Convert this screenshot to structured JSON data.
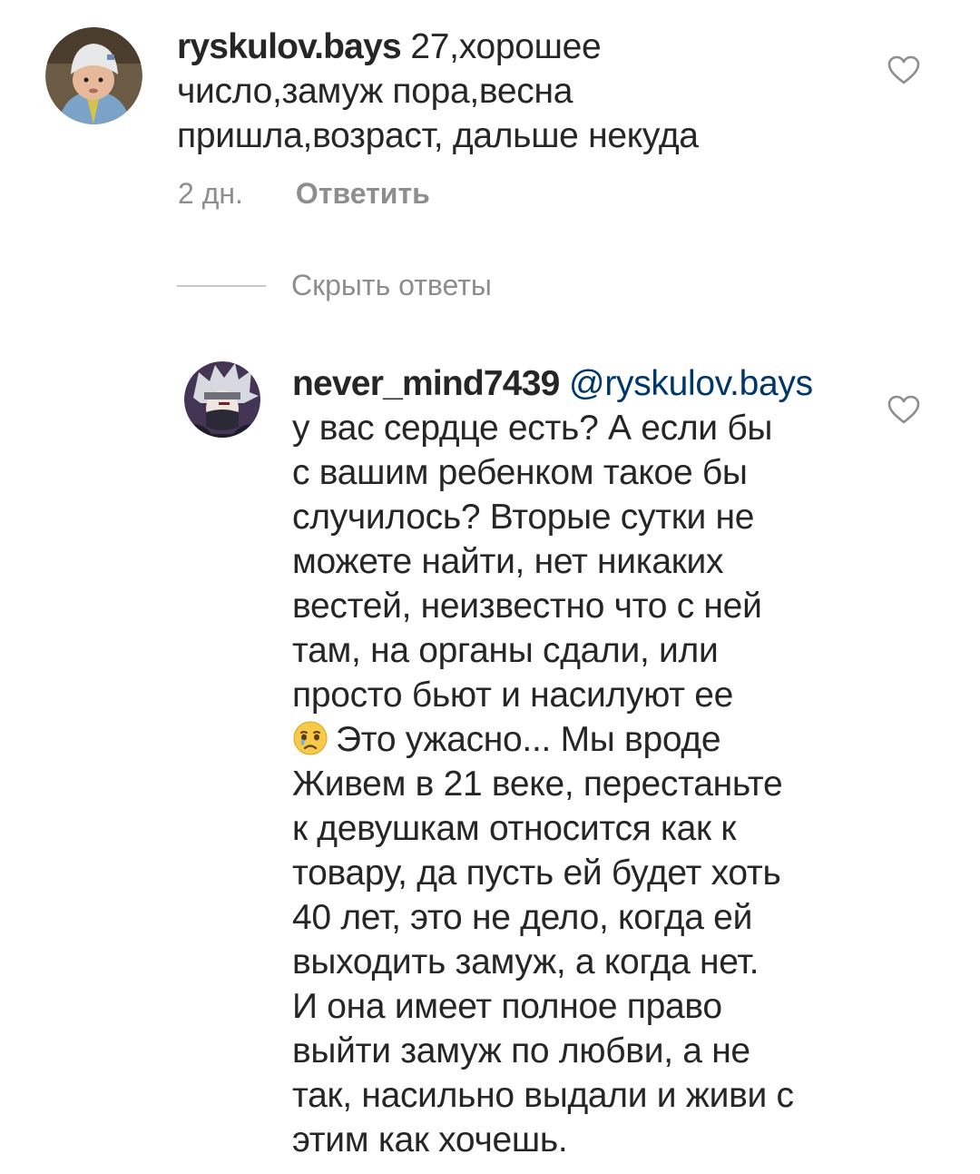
{
  "comment": {
    "username": "ryskulov.bays",
    "text": " 27,хорошее\nчисло,замуж пора,весна\nпришла,возраст, дальше некуда",
    "time": "2 дн.",
    "reply_label": "Ответить",
    "like_icon": "heart-outline-icon"
  },
  "hide_replies_label": "Скрыть ответы",
  "reply": {
    "username": "never_mind7439",
    "mention": "@ryskulov.bays",
    "text_before_emoji": "\nу вас сердце есть? А если бы\nс вашим ребенком такое бы\nслучилось? Вторые сутки не\nможете найти, нет никаких\nвестей, неизвестно что с ней\nтам, на органы сдали, или\nпросто бьют и насилуют ее\n",
    "emoji": "crying-face-emoji",
    "text_after_emoji": "Это ужасно... Мы вроде\nЖивем в 21 веке, перестаньте\nк девушкам относится как к\nтовару, да пусть ей будет хоть\n40 лет, это не дело, когда ей\nвыходить замуж, а когда нет.\nИ она имеет полное право\nвыйти замуж по любви, а не\nтак, насильно выдали и живи с\nэтим как хочешь.",
    "like_icon": "heart-outline-icon"
  },
  "colors": {
    "text": "#262626",
    "secondary": "#8e8e8e",
    "mention": "#00376b",
    "divider": "#c7c7c7"
  }
}
